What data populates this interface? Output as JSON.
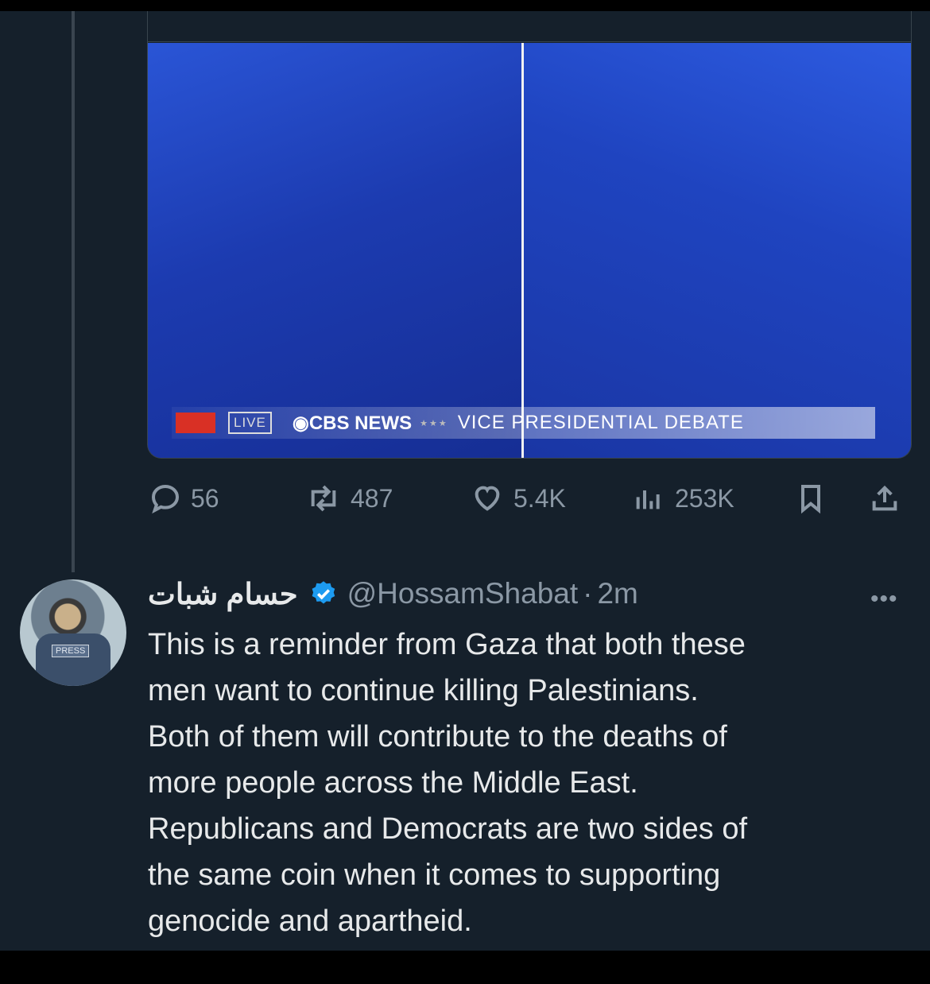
{
  "media": {
    "banner_live": "LIVE",
    "banner_network": "CBS NEWS",
    "banner_stars": "★★★",
    "banner_title": "VICE PRESIDENTIAL DEBATE"
  },
  "actions": {
    "replies": "56",
    "retweets": "487",
    "likes": "5.4K",
    "views": "253K"
  },
  "reply": {
    "display_name": "حسام شبات",
    "handle": "@HossamShabat",
    "separator": "·",
    "time": "2m",
    "more": "•••",
    "avatar_badge": "PRESS",
    "text": "This is a reminder from Gaza that both these\nmen want to continue killing Palestinians.\nBoth of them will contribute to the deaths of\nmore people  across the Middle East.\nRepublicans and Democrats are two sides of\nthe same coin when it comes to supporting\ngenocide and apartheid."
  },
  "colors": {
    "background": "#15202b",
    "verified": "#1d9bf0",
    "muted": "#8b98a5"
  }
}
